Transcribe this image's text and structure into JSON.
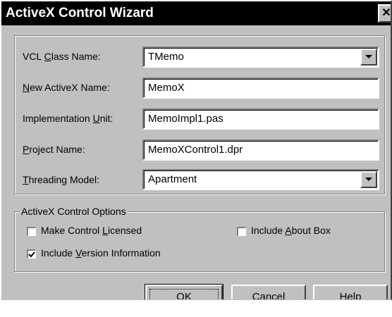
{
  "window": {
    "title": "ActiveX Control Wizard",
    "close_glyph": "✕"
  },
  "fields": {
    "vcl_class": {
      "label_pre": "VCL ",
      "label_key": "C",
      "label_post": "lass Name:",
      "value": "TMemo"
    },
    "new_activex": {
      "label_pre": "",
      "label_key": "N",
      "label_post": "ew ActiveX Name:",
      "value": "MemoX"
    },
    "impl_unit": {
      "label_pre": "Implementation ",
      "label_key": "U",
      "label_post": "nit:",
      "value": "MemoImpl1.pas"
    },
    "project_name": {
      "label_pre": "",
      "label_key": "P",
      "label_post": "roject Name:",
      "value": "MemoXControl1.dpr"
    },
    "threading": {
      "label_pre": "",
      "label_key": "T",
      "label_post": "hreading Model:",
      "value": "Apartment"
    }
  },
  "options": {
    "group_label": "ActiveX Control Options",
    "licensed": {
      "pre": "Make Control ",
      "key": "L",
      "post": "icensed",
      "checked": false
    },
    "about_box": {
      "pre": "Include ",
      "key": "A",
      "post": "bout Box",
      "checked": false
    },
    "version_info": {
      "pre": "Include ",
      "key": "V",
      "post": "ersion Information",
      "checked": true
    }
  },
  "buttons": {
    "ok": "OK",
    "cancel": "Cancel",
    "help_key": "H",
    "help_post": "elp"
  },
  "icons": {
    "close": "close-icon",
    "dropdown": "chevron-down-icon",
    "check": "checkmark-icon"
  }
}
